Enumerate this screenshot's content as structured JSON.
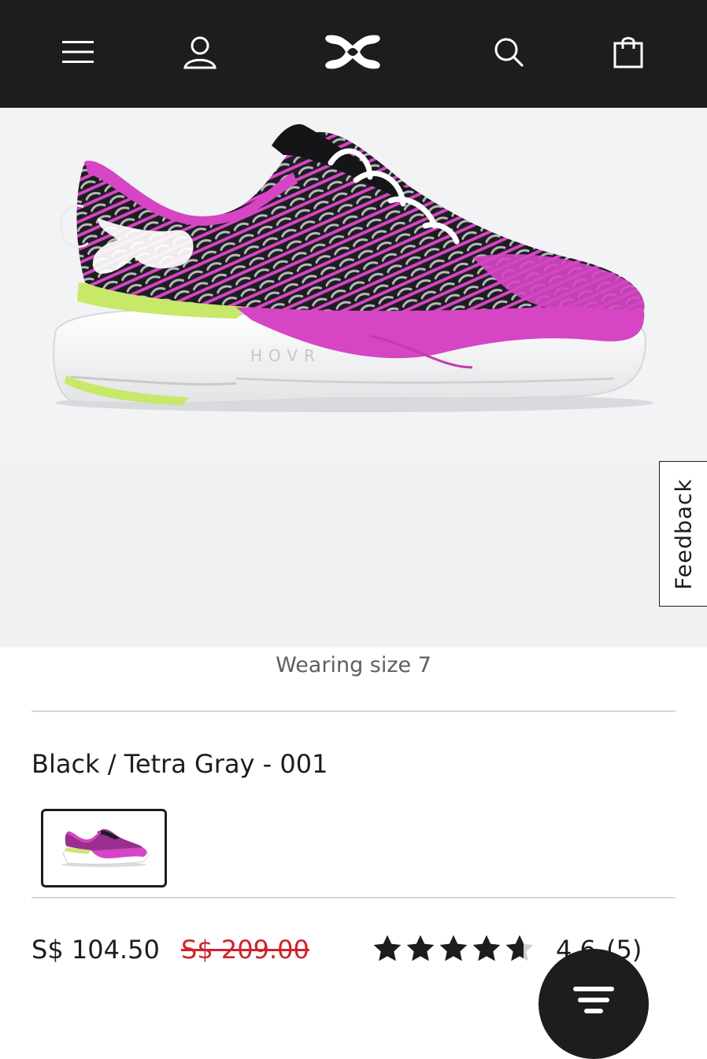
{
  "header": {
    "icons": [
      "menu-icon",
      "account-icon",
      "brand-logo",
      "search-icon",
      "shopping-bag-icon"
    ]
  },
  "hero": {
    "product_image": "running-shoe-pink-black",
    "feedback_label": "Feedback"
  },
  "product": {
    "wearing_caption": "Wearing size 7",
    "color_name": "Black / Tetra Gray - 001",
    "price_current": "S$ 104.50",
    "price_original": "S$ 209.00",
    "rating_value": "4.6",
    "rating_count": "(5)",
    "rating_stars": 4.6
  },
  "colors": {
    "topbar": "#1d1d1d",
    "accent_pink": "#d645c4",
    "accent_lime": "#c8e86a",
    "sale_red": "#d0232a"
  },
  "chat_fab_icon": "chat-lines-icon"
}
